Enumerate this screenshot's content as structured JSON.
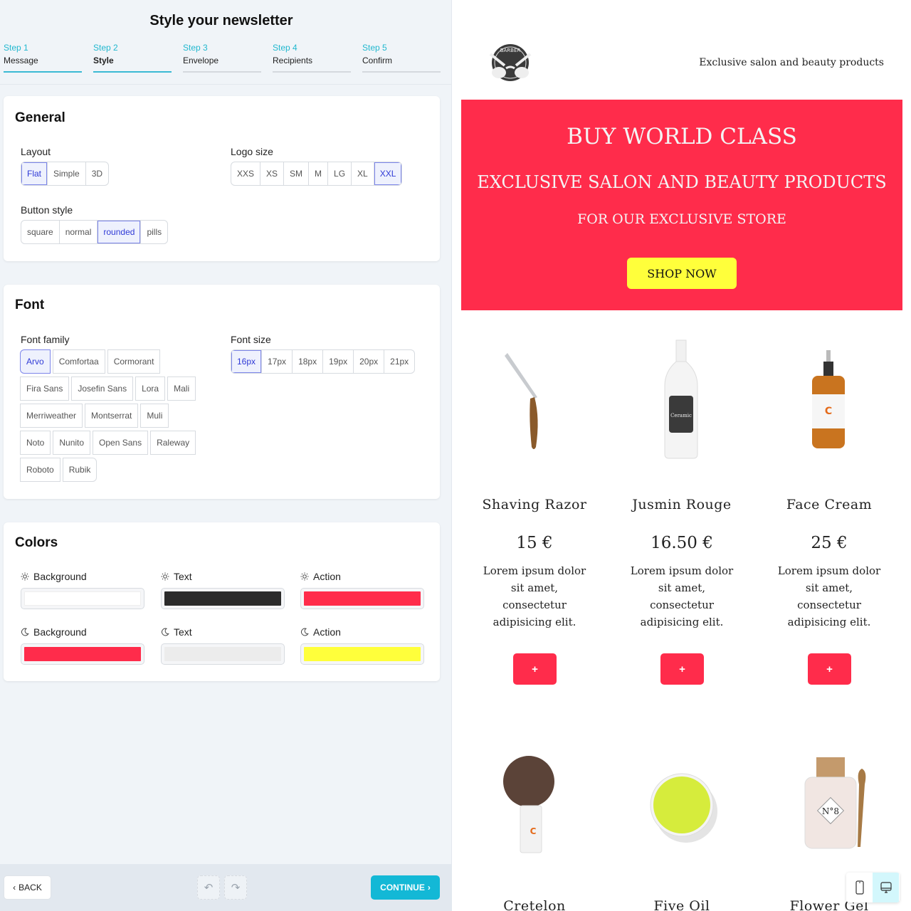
{
  "page_title": "Style your newsletter",
  "steps": [
    {
      "num": "Step 1",
      "label": "Message",
      "state": "done"
    },
    {
      "num": "Step 2",
      "label": "Style",
      "state": "active"
    },
    {
      "num": "Step 3",
      "label": "Envelope",
      "state": "todo"
    },
    {
      "num": "Step 4",
      "label": "Recipients",
      "state": "todo"
    },
    {
      "num": "Step 5",
      "label": "Confirm",
      "state": "todo"
    }
  ],
  "general": {
    "title": "General",
    "layout": {
      "label": "Layout",
      "options": [
        "Flat",
        "Simple",
        "3D"
      ],
      "selected": "Flat"
    },
    "logo_size": {
      "label": "Logo size",
      "options": [
        "XXS",
        "XS",
        "SM",
        "M",
        "LG",
        "XL",
        "XXL"
      ],
      "selected": "XXL"
    },
    "button_style": {
      "label": "Button style",
      "options": [
        "square",
        "normal",
        "rounded",
        "pills"
      ],
      "selected": "rounded"
    }
  },
  "font": {
    "title": "Font",
    "family": {
      "label": "Font family",
      "rows": [
        [
          "Arvo",
          "Comfortaa",
          "Cormorant"
        ],
        [
          "Fira Sans",
          "Josefin Sans",
          "Lora",
          "Mali"
        ],
        [
          "Merriweather",
          "Montserrat",
          "Muli"
        ],
        [
          "Noto",
          "Nunito",
          "Open Sans",
          "Raleway"
        ],
        [
          "Roboto",
          "Rubik"
        ]
      ],
      "selected": "Arvo"
    },
    "size": {
      "label": "Font size",
      "options": [
        "16px",
        "17px",
        "18px",
        "19px",
        "20px",
        "21px"
      ],
      "selected": "16px"
    }
  },
  "colors": {
    "title": "Colors",
    "light": [
      {
        "label": "Background",
        "value": "#ffffff",
        "icon": "sun-icon"
      },
      {
        "label": "Text",
        "value": "#2b2b2b",
        "icon": "sun-icon"
      },
      {
        "label": "Action",
        "value": "#ff2c4b",
        "icon": "sun-icon"
      }
    ],
    "dark": [
      {
        "label": "Background",
        "value": "#ff2c4b",
        "icon": "moon-icon"
      },
      {
        "label": "Text",
        "value": "#ececec",
        "icon": "moon-icon"
      },
      {
        "label": "Action",
        "value": "#ffff3b",
        "icon": "moon-icon"
      }
    ]
  },
  "footer": {
    "back_label": "BACK",
    "continue_label": "CONTINUE"
  },
  "preview": {
    "tagline": "Exclusive salon and beauty products",
    "hero": {
      "line1": "BUY WORLD CLASS",
      "line2": "EXCLUSIVE SALON AND BEAUTY PRODUCTS",
      "line3": "FOR OUR EXCLUSIVE STORE",
      "cta": "SHOP NOW",
      "bg_color": "#ff2c4b",
      "cta_color": "#ffff3b"
    },
    "products": [
      {
        "name": "Shaving Razor",
        "price": "15 €",
        "desc": "Lorem ipsum dolor sit amet, consectetur adipisicing elit.",
        "add": "+"
      },
      {
        "name": "Jusmin Rouge",
        "price": "16.50 €",
        "desc": "Lorem ipsum dolor sit amet, consectetur adipisicing elit.",
        "add": "+"
      },
      {
        "name": "Face Cream",
        "price": "25 €",
        "desc": "Lorem ipsum dolor sit amet, consectetur adipisicing elit.",
        "add": "+"
      },
      {
        "name": "Cretelon",
        "price": "",
        "desc": "",
        "add": ""
      },
      {
        "name": "Five Oil",
        "price": "",
        "desc": "",
        "add": ""
      },
      {
        "name": "Flower Gel",
        "price": "",
        "desc": "",
        "add": ""
      }
    ],
    "view_modes": [
      "mobile",
      "desktop"
    ],
    "view_selected": "desktop"
  }
}
